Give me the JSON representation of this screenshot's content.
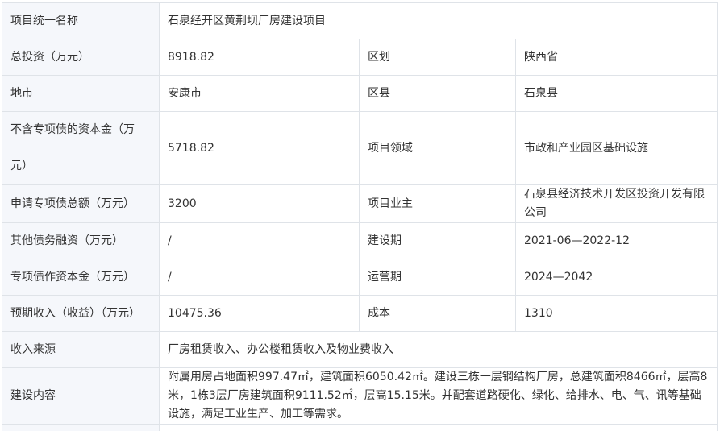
{
  "rows": [
    {
      "label": "项目统一名称",
      "value": "石泉经开区黄荆坝厂房建设项目"
    },
    {
      "label": "总投资（万元）",
      "value": "8918.82",
      "label2": "区划",
      "value2": "陕西省"
    },
    {
      "label": "地市",
      "value": "安康市",
      "label2": "区县",
      "value2": "石泉县"
    },
    {
      "label": "不含专项债的资本金（万元）",
      "value": "5718.82",
      "label2": "项目领域",
      "value2": "市政和产业园区基础设施"
    },
    {
      "label": "申请专项债总额（万元）",
      "value": "3200",
      "label2": "项目业主",
      "value2": "石泉县经济技术开发区投资开发有限公司"
    },
    {
      "label": "其他债务融资（万元）",
      "value": "/",
      "label2": "建设期",
      "value2": "2021-06—2022-12"
    },
    {
      "label": "专项债作资本金（万元）",
      "value": "/",
      "label2": "运营期",
      "value2": "2024—2042"
    },
    {
      "label": "预期收入（收益）（万元）",
      "value": "10475.36",
      "label2": "成本",
      "value2": "1310"
    },
    {
      "label": "收入来源",
      "value": "厂房租赁收入、办公楼租赁收入及物业费收入"
    },
    {
      "label": "建设内容",
      "value": "附属用房占地面积997.47㎡，建筑面积6050.42㎡。建设三栋一层钢结构厂房，总建筑面积8466㎡，层高8米，1栋3层厂房建筑面积9111.52㎡，层高15.15米。并配套道路硬化、绿化、给排水、电、气、讯等基础设施，满足工业生产、加工等需求。"
    }
  ]
}
